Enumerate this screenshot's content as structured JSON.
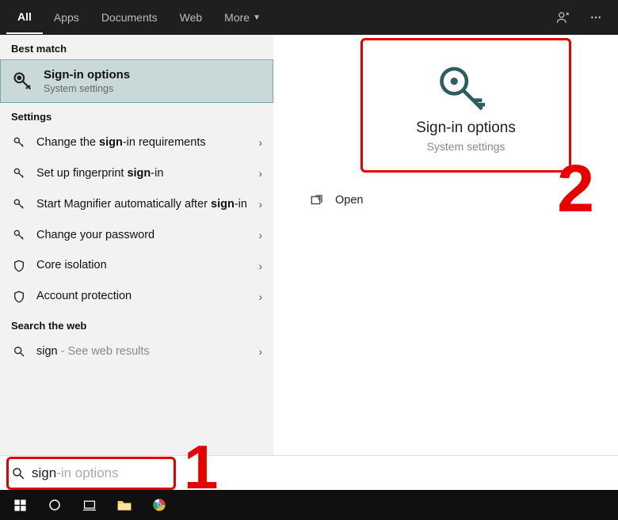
{
  "tabs": {
    "all": "All",
    "apps": "Apps",
    "documents": "Documents",
    "web": "Web",
    "more": "More"
  },
  "sections": {
    "best_match": "Best match",
    "settings": "Settings",
    "search_web": "Search the web"
  },
  "best_match": {
    "title": "Sign-in options",
    "subtitle": "System settings"
  },
  "settings_items": [
    {
      "pre": "Change the ",
      "hl": "sign",
      "post": "-in requirements"
    },
    {
      "pre": "Set up fingerprint ",
      "hl": "sign",
      "post": "-in"
    },
    {
      "pre": "Start Magnifier automatically after ",
      "hl": "sign",
      "post": "-in"
    },
    {
      "pre": "Change your password",
      "hl": "",
      "post": ""
    },
    {
      "pre": "Core isolation",
      "hl": "",
      "post": ""
    },
    {
      "pre": "Account protection",
      "hl": "",
      "post": ""
    }
  ],
  "web_item": {
    "term": "sign",
    "suffix": " - See web results"
  },
  "preview": {
    "title": "Sign-in options",
    "subtitle": "System settings",
    "open": "Open"
  },
  "search": {
    "typed": "sign",
    "ghost": "-in options"
  },
  "annotations": {
    "one": "1",
    "two": "2"
  }
}
